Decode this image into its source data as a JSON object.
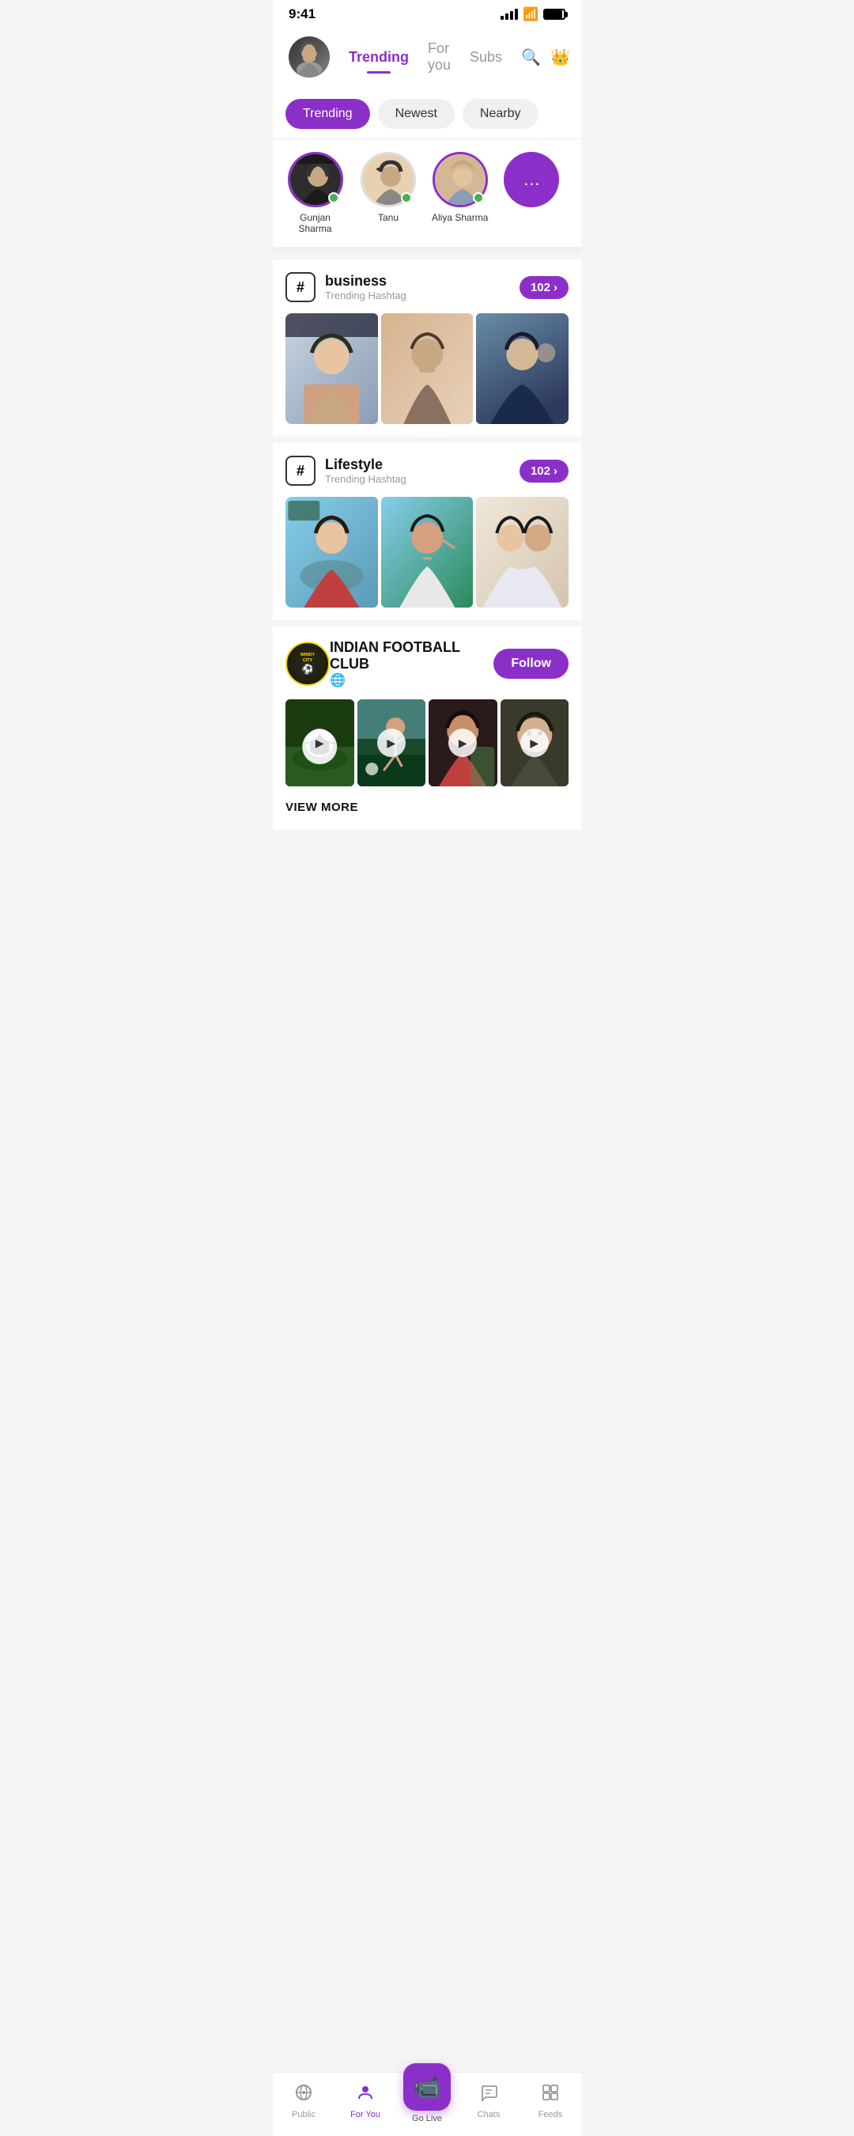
{
  "status": {
    "time": "9:41",
    "signal": 4,
    "battery": 90
  },
  "header": {
    "trending_label": "Trending",
    "for_you_label": "For you",
    "subs_label": "Subs",
    "active_tab": "trending"
  },
  "filter_pills": [
    {
      "label": "Trending",
      "active": true
    },
    {
      "label": "Newest",
      "active": false
    },
    {
      "label": "Nearby",
      "active": false
    }
  ],
  "stories": [
    {
      "name": "Gunjan Sharma",
      "online": true,
      "has_ring": true
    },
    {
      "name": "Tanu",
      "online": true,
      "has_ring": false
    },
    {
      "name": "Aliya Sharma",
      "online": true,
      "has_ring": true
    }
  ],
  "hashtags": [
    {
      "tag": "business",
      "subtitle": "Trending Hashtag",
      "count": "102"
    },
    {
      "tag": "Lifestyle",
      "subtitle": "Trending Hashtag",
      "count": "102"
    }
  ],
  "club": {
    "name": "INDIAN FOOTBALL CLUB",
    "logo_line1": "WINDY",
    "logo_line2": "city",
    "follow_label": "Follow",
    "view_more_label": "VIEW MORE"
  },
  "bottom_nav": [
    {
      "label": "Public",
      "icon": "📡",
      "active": false
    },
    {
      "label": "For You",
      "icon": "👤",
      "active": true
    },
    {
      "label": "Go Live",
      "icon": "📹",
      "active": false,
      "is_center": true
    },
    {
      "label": "Chats",
      "icon": "💬",
      "active": false
    },
    {
      "label": "Feeds",
      "icon": "📋",
      "active": false
    }
  ]
}
